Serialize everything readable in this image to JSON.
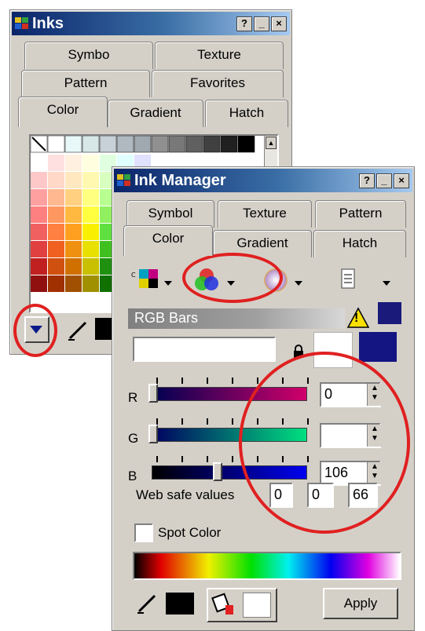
{
  "inks_window": {
    "title": "Inks",
    "title_buttons": [
      "?",
      "_",
      "×"
    ],
    "tabs_row1": [
      "Symbo",
      "Texture"
    ],
    "tabs_row2": [
      "Pattern",
      "Favorites"
    ],
    "tabs_row3": [
      "Color",
      "Gradient",
      "Hatch"
    ]
  },
  "manager_window": {
    "title": "Ink Manager",
    "title_buttons": [
      "?",
      "_",
      "×"
    ],
    "tabs_row1": [
      "Symbol",
      "Texture",
      "Pattern"
    ],
    "tabs_row2": [
      "Color",
      "Gradient",
      "Hatch"
    ],
    "model_bar": "RGB Bars",
    "warning_glyph": "!",
    "sliders": [
      {
        "label": "R",
        "value": "0",
        "level": 0.0
      },
      {
        "label": "G",
        "value": "",
        "level": 0.0
      },
      {
        "label": "B",
        "value": "106",
        "level": 0.42
      }
    ],
    "web_safe_label": "Web safe values",
    "web_safe_values": [
      "0",
      "0",
      "66"
    ],
    "spot_color_label": "Spot Color",
    "apply_label": "Apply"
  },
  "colors": {
    "current_color": "#1a1a7a",
    "accent_ring": "#e02020"
  }
}
